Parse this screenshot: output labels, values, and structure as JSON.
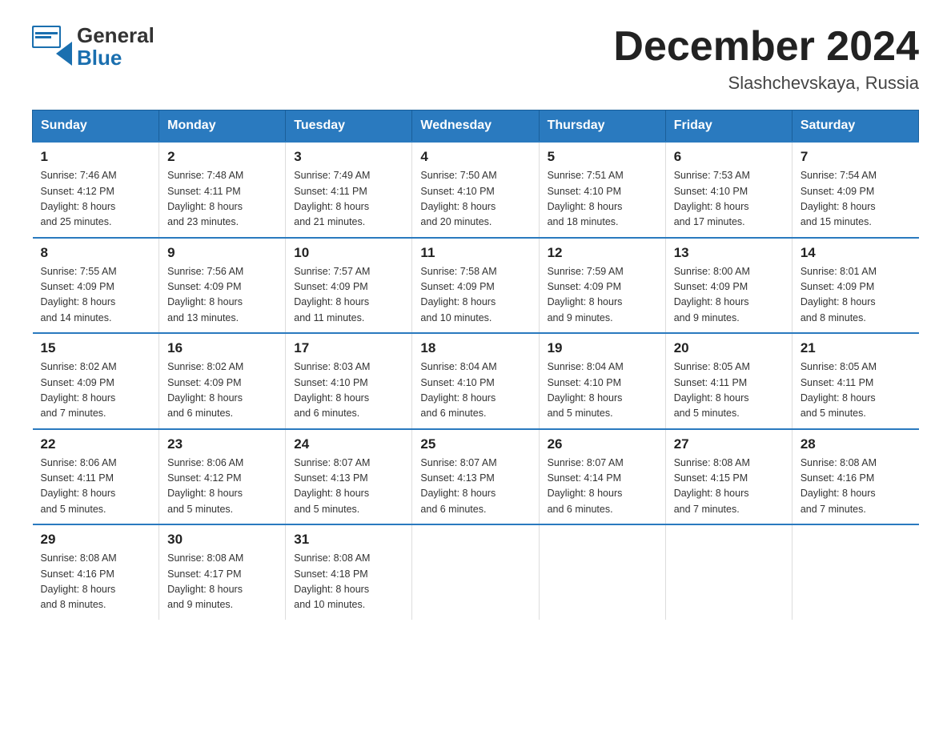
{
  "header": {
    "logo_general": "General",
    "logo_blue": "Blue",
    "month_year": "December 2024",
    "location": "Slashchevskaya, Russia"
  },
  "days_of_week": [
    "Sunday",
    "Monday",
    "Tuesday",
    "Wednesday",
    "Thursday",
    "Friday",
    "Saturday"
  ],
  "weeks": [
    [
      {
        "day": "1",
        "sunrise": "7:46 AM",
        "sunset": "4:12 PM",
        "daylight": "8 hours and 25 minutes."
      },
      {
        "day": "2",
        "sunrise": "7:48 AM",
        "sunset": "4:11 PM",
        "daylight": "8 hours and 23 minutes."
      },
      {
        "day": "3",
        "sunrise": "7:49 AM",
        "sunset": "4:11 PM",
        "daylight": "8 hours and 21 minutes."
      },
      {
        "day": "4",
        "sunrise": "7:50 AM",
        "sunset": "4:10 PM",
        "daylight": "8 hours and 20 minutes."
      },
      {
        "day": "5",
        "sunrise": "7:51 AM",
        "sunset": "4:10 PM",
        "daylight": "8 hours and 18 minutes."
      },
      {
        "day": "6",
        "sunrise": "7:53 AM",
        "sunset": "4:10 PM",
        "daylight": "8 hours and 17 minutes."
      },
      {
        "day": "7",
        "sunrise": "7:54 AM",
        "sunset": "4:09 PM",
        "daylight": "8 hours and 15 minutes."
      }
    ],
    [
      {
        "day": "8",
        "sunrise": "7:55 AM",
        "sunset": "4:09 PM",
        "daylight": "8 hours and 14 minutes."
      },
      {
        "day": "9",
        "sunrise": "7:56 AM",
        "sunset": "4:09 PM",
        "daylight": "8 hours and 13 minutes."
      },
      {
        "day": "10",
        "sunrise": "7:57 AM",
        "sunset": "4:09 PM",
        "daylight": "8 hours and 11 minutes."
      },
      {
        "day": "11",
        "sunrise": "7:58 AM",
        "sunset": "4:09 PM",
        "daylight": "8 hours and 10 minutes."
      },
      {
        "day": "12",
        "sunrise": "7:59 AM",
        "sunset": "4:09 PM",
        "daylight": "8 hours and 9 minutes."
      },
      {
        "day": "13",
        "sunrise": "8:00 AM",
        "sunset": "4:09 PM",
        "daylight": "8 hours and 9 minutes."
      },
      {
        "day": "14",
        "sunrise": "8:01 AM",
        "sunset": "4:09 PM",
        "daylight": "8 hours and 8 minutes."
      }
    ],
    [
      {
        "day": "15",
        "sunrise": "8:02 AM",
        "sunset": "4:09 PM",
        "daylight": "8 hours and 7 minutes."
      },
      {
        "day": "16",
        "sunrise": "8:02 AM",
        "sunset": "4:09 PM",
        "daylight": "8 hours and 6 minutes."
      },
      {
        "day": "17",
        "sunrise": "8:03 AM",
        "sunset": "4:10 PM",
        "daylight": "8 hours and 6 minutes."
      },
      {
        "day": "18",
        "sunrise": "8:04 AM",
        "sunset": "4:10 PM",
        "daylight": "8 hours and 6 minutes."
      },
      {
        "day": "19",
        "sunrise": "8:04 AM",
        "sunset": "4:10 PM",
        "daylight": "8 hours and 5 minutes."
      },
      {
        "day": "20",
        "sunrise": "8:05 AM",
        "sunset": "4:11 PM",
        "daylight": "8 hours and 5 minutes."
      },
      {
        "day": "21",
        "sunrise": "8:05 AM",
        "sunset": "4:11 PM",
        "daylight": "8 hours and 5 minutes."
      }
    ],
    [
      {
        "day": "22",
        "sunrise": "8:06 AM",
        "sunset": "4:11 PM",
        "daylight": "8 hours and 5 minutes."
      },
      {
        "day": "23",
        "sunrise": "8:06 AM",
        "sunset": "4:12 PM",
        "daylight": "8 hours and 5 minutes."
      },
      {
        "day": "24",
        "sunrise": "8:07 AM",
        "sunset": "4:13 PM",
        "daylight": "8 hours and 5 minutes."
      },
      {
        "day": "25",
        "sunrise": "8:07 AM",
        "sunset": "4:13 PM",
        "daylight": "8 hours and 6 minutes."
      },
      {
        "day": "26",
        "sunrise": "8:07 AM",
        "sunset": "4:14 PM",
        "daylight": "8 hours and 6 minutes."
      },
      {
        "day": "27",
        "sunrise": "8:08 AM",
        "sunset": "4:15 PM",
        "daylight": "8 hours and 7 minutes."
      },
      {
        "day": "28",
        "sunrise": "8:08 AM",
        "sunset": "4:16 PM",
        "daylight": "8 hours and 7 minutes."
      }
    ],
    [
      {
        "day": "29",
        "sunrise": "8:08 AM",
        "sunset": "4:16 PM",
        "daylight": "8 hours and 8 minutes."
      },
      {
        "day": "30",
        "sunrise": "8:08 AM",
        "sunset": "4:17 PM",
        "daylight": "8 hours and 9 minutes."
      },
      {
        "day": "31",
        "sunrise": "8:08 AM",
        "sunset": "4:18 PM",
        "daylight": "8 hours and 10 minutes."
      },
      null,
      null,
      null,
      null
    ]
  ],
  "labels": {
    "sunrise": "Sunrise:",
    "sunset": "Sunset:",
    "daylight": "Daylight:"
  }
}
